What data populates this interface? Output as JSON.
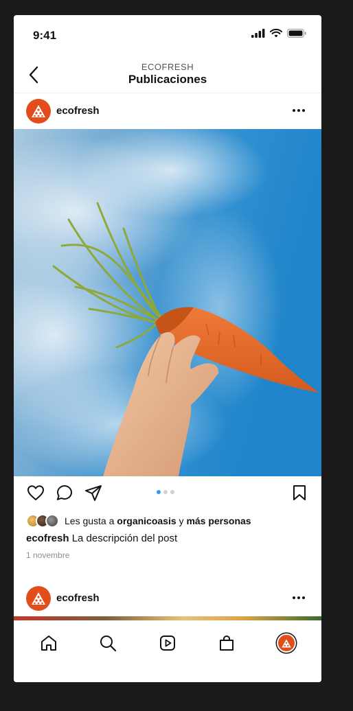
{
  "status_bar": {
    "time": "9:41"
  },
  "header": {
    "brand": "ECOFRESH",
    "title": "Publicaciones"
  },
  "posts": [
    {
      "username": "ecofresh",
      "likes": {
        "prefix": "Les gusta a",
        "user": "organicoasis",
        "conj": "y",
        "others": "más personas"
      },
      "caption": {
        "user": "ecofresh",
        "text": "La descripción del post"
      },
      "date": "1 novembre",
      "carousel": {
        "total": 3,
        "active": 1
      }
    },
    {
      "username": "ecofresh"
    }
  ],
  "colors": {
    "brand": "#e24e1b",
    "accent": "#3897f0",
    "sky": "#2f8fd0",
    "carrot": "#e8682a"
  },
  "icons": {
    "tabs": [
      "home-icon",
      "search-icon",
      "reels-icon",
      "shop-icon",
      "profile-avatar"
    ],
    "actions": [
      "heart-icon",
      "comment-icon",
      "share-icon",
      "bookmark-icon"
    ]
  }
}
